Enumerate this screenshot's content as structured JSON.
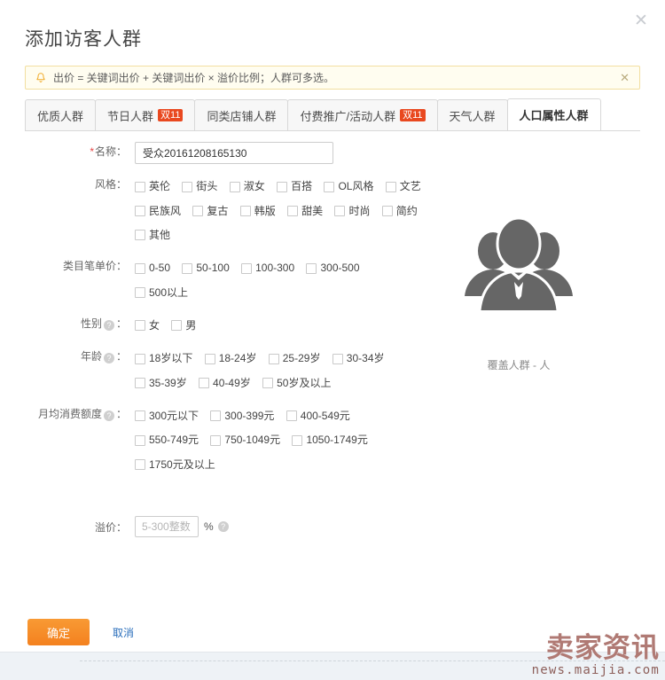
{
  "dialog": {
    "title": "添加访客人群",
    "close_label": "✕"
  },
  "alert": {
    "icon": "bell-icon",
    "text": "出价 = 关键词出价 + 关键词出价 × 溢价比例；人群可多选。",
    "close_label": "✕"
  },
  "tabs": [
    {
      "label": "优质人群",
      "badge": "",
      "active": false
    },
    {
      "label": "节日人群",
      "badge": "双11",
      "active": false
    },
    {
      "label": "同类店铺人群",
      "badge": "",
      "active": false
    },
    {
      "label": "付费推广/活动人群",
      "badge": "双11",
      "active": false
    },
    {
      "label": "天气人群",
      "badge": "",
      "active": false
    },
    {
      "label": "人口属性人群",
      "badge": "",
      "active": true
    }
  ],
  "form": {
    "name": {
      "label": "名称：",
      "required_mark": "*",
      "value": "受众20161208165130",
      "placeholder": ""
    },
    "style": {
      "label": "风格：",
      "lines": [
        [
          "英伦",
          "街头",
          "淑女",
          "百搭",
          "OL风格",
          "文艺"
        ],
        [
          "民族风",
          "复古",
          "韩版",
          "甜美",
          "时尚",
          "简约"
        ],
        [
          "其他"
        ]
      ]
    },
    "unit_price": {
      "label": "类目笔单价：",
      "lines": [
        [
          "0-50",
          "50-100",
          "100-300",
          "300-500"
        ],
        [
          "500以上"
        ]
      ]
    },
    "gender": {
      "label": "性别",
      "suffix": "：",
      "help": "?",
      "lines": [
        [
          "女",
          "男"
        ]
      ]
    },
    "age": {
      "label": "年龄",
      "suffix": "：",
      "help": "?",
      "lines": [
        [
          "18岁以下",
          "18-24岁",
          "25-29岁",
          "30-34岁"
        ],
        [
          "35-39岁",
          "40-49岁",
          "50岁及以上"
        ]
      ]
    },
    "monthly_spend": {
      "label": "月均消费额度",
      "suffix": "：",
      "help": "?",
      "lines": [
        [
          "300元以下",
          "300-399元",
          "400-549元"
        ],
        [
          "550-749元",
          "750-1049元",
          "1050-1749元"
        ],
        [
          "1750元及以上"
        ]
      ]
    },
    "premium": {
      "label": "溢价：",
      "value": "",
      "placeholder": "5-300整数",
      "unit": "%",
      "help": "?"
    }
  },
  "illustration": {
    "icon": "people-group-icon",
    "caption": "覆盖人群 - 人",
    "color": "#666666"
  },
  "footer": {
    "confirm_label": "确定",
    "cancel_label": "取消",
    "confirm_color": "#f4811f"
  },
  "watermark": {
    "main": "卖家资讯",
    "sub": "news.maijia.com"
  }
}
